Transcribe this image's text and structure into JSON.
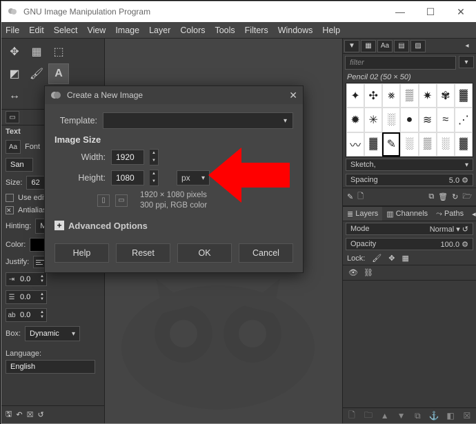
{
  "window_title": "GNU Image Manipulation Program",
  "menus": [
    "File",
    "Edit",
    "Select",
    "View",
    "Image",
    "Layer",
    "Colors",
    "Tools",
    "Filters",
    "Windows",
    "Help"
  ],
  "tool_options": {
    "header": "Text",
    "font_label": "Font",
    "font_value": "San",
    "size_label": "Size:",
    "size_value": "62",
    "use_editor_label": "Use edit",
    "antialias_label": "Antialias",
    "hinting_label": "Hinting:",
    "hinting_value": "Medium",
    "color_label": "Color:",
    "justify_label": "Justify:",
    "indent1": "0.0",
    "indent2": "0.0",
    "indent3": "0.0",
    "box_label": "Box:",
    "box_value": "Dynamic",
    "language_label": "Language:",
    "language_value": "English"
  },
  "dialog": {
    "title": "Create a New Image",
    "template_label": "Template:",
    "image_size_header": "Image Size",
    "width_label": "Width:",
    "width_value": "1920",
    "height_label": "Height:",
    "height_value": "1080",
    "unit": "px",
    "info_line1": "1920 × 1080 pixels",
    "info_line2": "300 ppi, RGB color",
    "advanced_label": "Advanced Options",
    "btn_help": "Help",
    "btn_reset": "Reset",
    "btn_ok": "OK",
    "btn_cancel": "Cancel"
  },
  "right": {
    "filter_placeholder": "filter",
    "brush_label": "Pencil 02 (50 × 50)",
    "sketch_label": "Sketch,",
    "spacing_label": "Spacing",
    "spacing_value": "5.0",
    "layers_tab": "Layers",
    "channels_tab": "Channels",
    "paths_tab": "Paths",
    "mode_label": "Mode",
    "mode_value": "Normal",
    "opacity_label": "Opacity",
    "opacity_value": "100.0",
    "lock_label": "Lock:"
  }
}
